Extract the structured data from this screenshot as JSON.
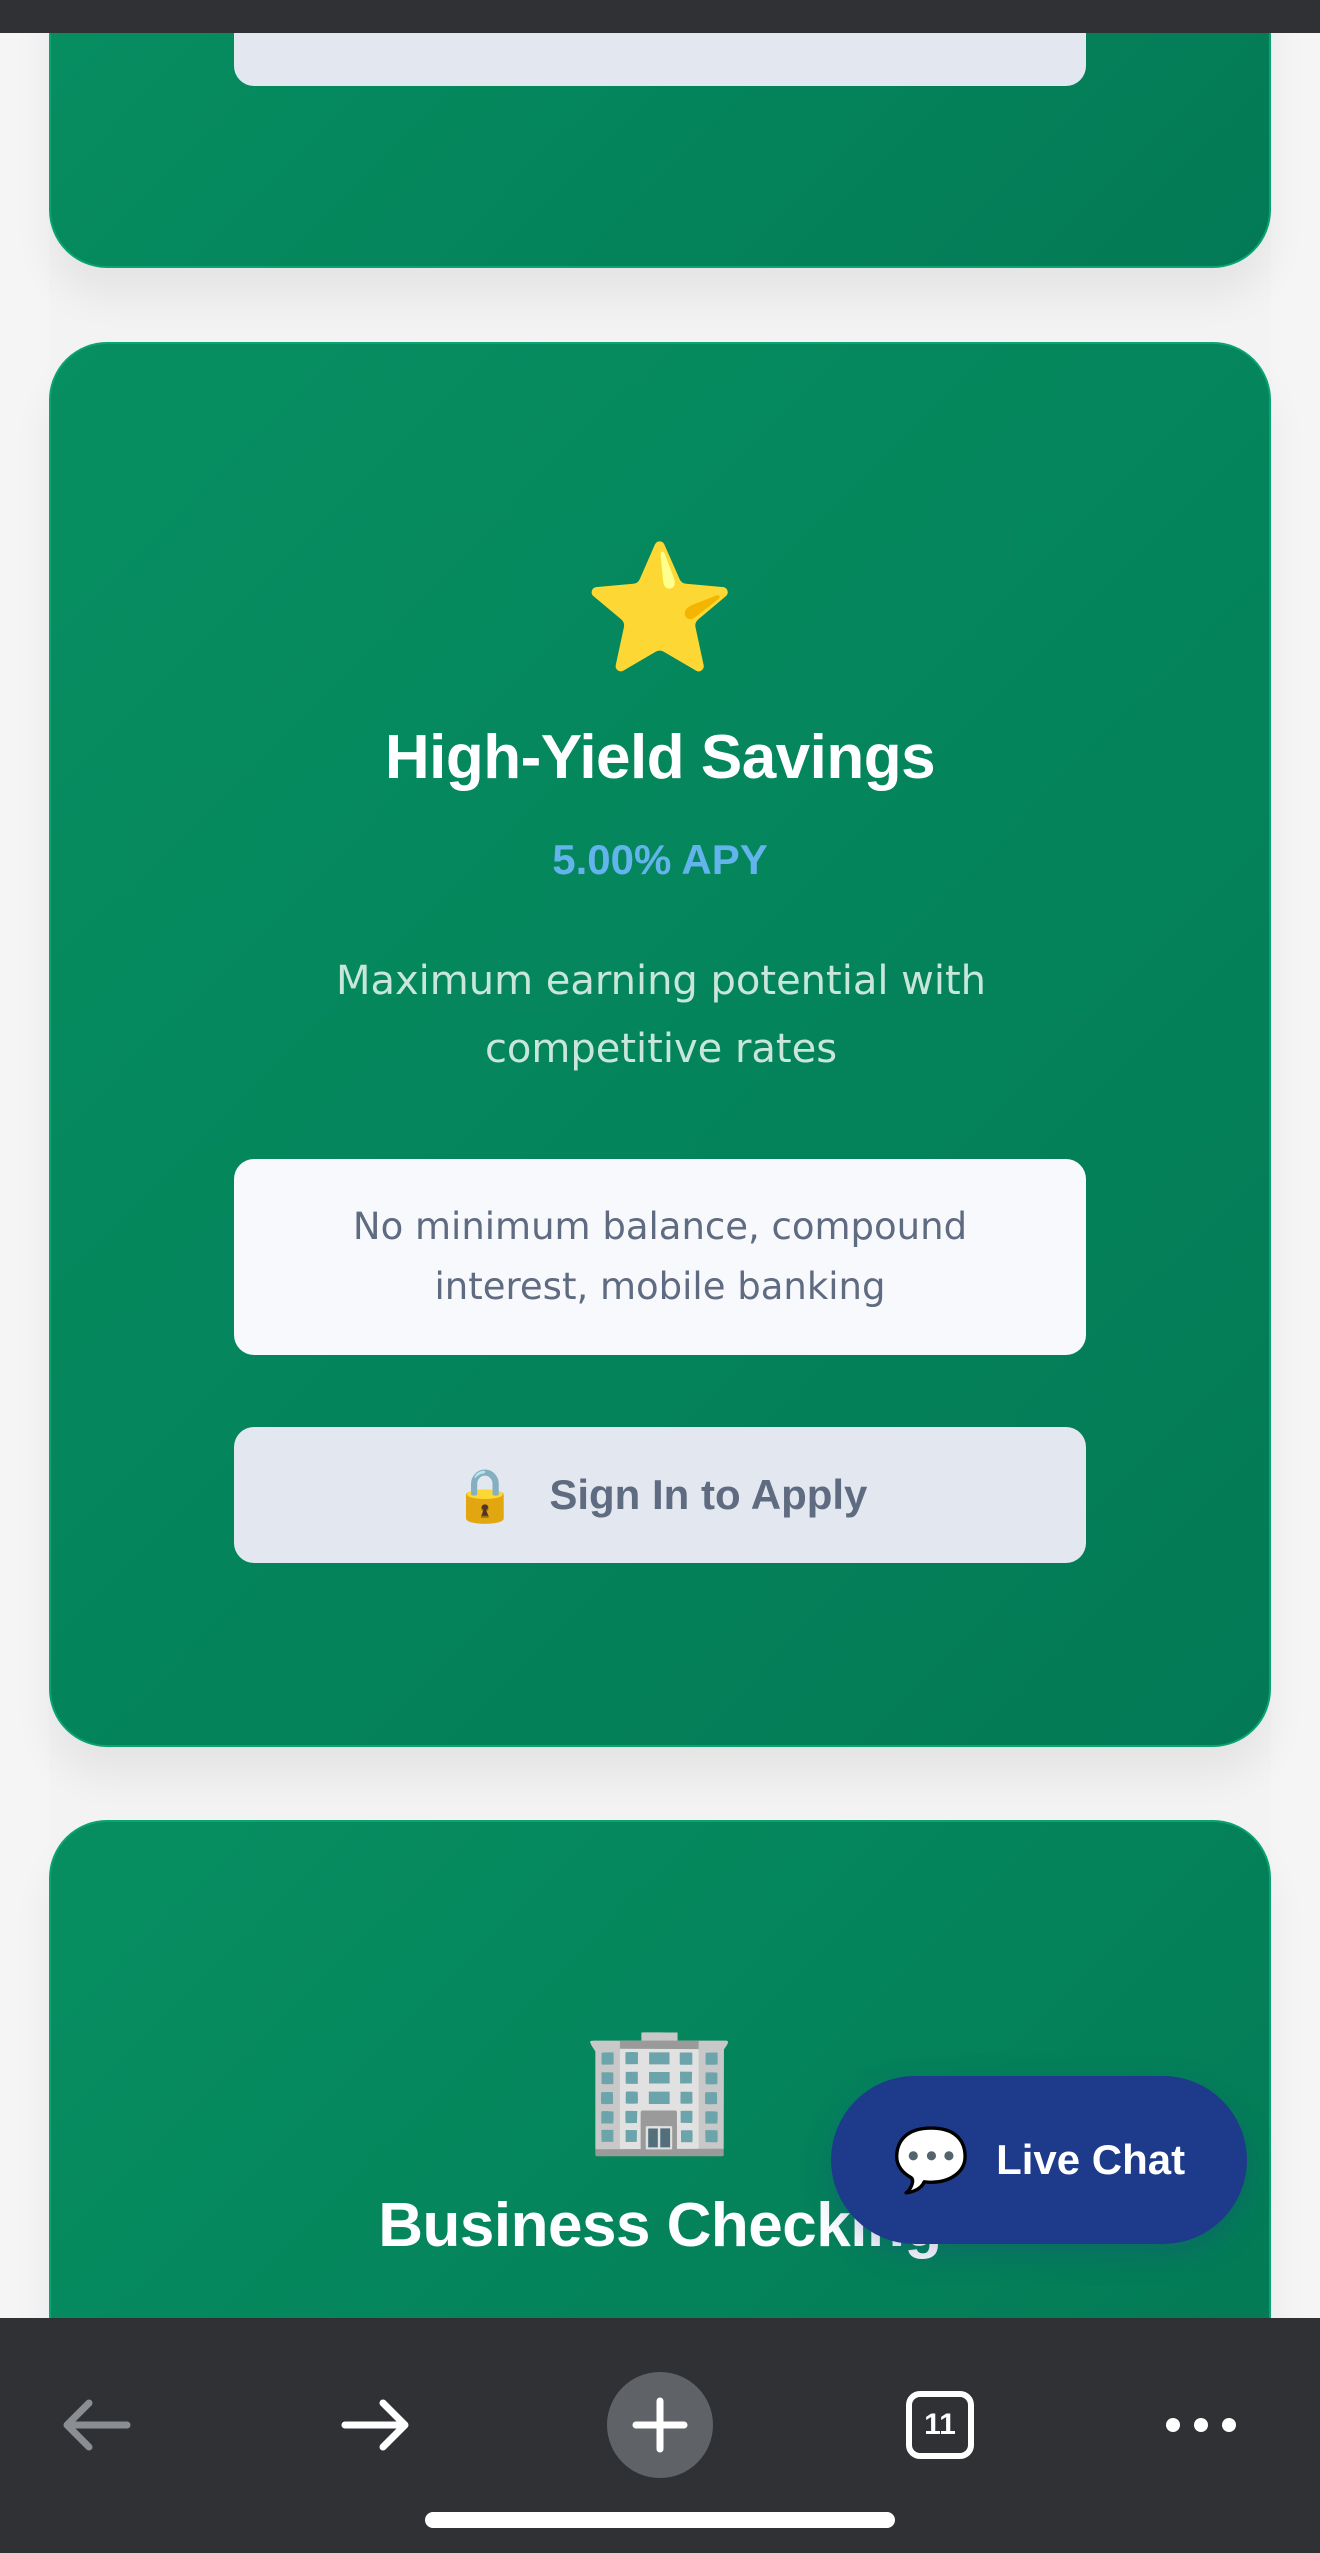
{
  "cards": [
    {
      "id": "partial-top",
      "apply_button_partial": true
    },
    {
      "id": "high-yield-savings",
      "icon": "⭐",
      "icon_name": "star-icon",
      "title": "High-Yield Savings",
      "rate": "5.00% APY",
      "description": "Maximum earning potential with competitive rates",
      "features": "No minimum balance, compound interest, mobile banking",
      "apply_label": "Sign In to Apply",
      "apply_icon": "🔒",
      "apply_icon_name": "lock-icon"
    },
    {
      "id": "business-checking",
      "icon": "🏢",
      "icon_name": "office-building-icon",
      "title": "Business Checking"
    }
  ],
  "live_chat": {
    "label": "Live Chat",
    "icon": "💬",
    "icon_name": "speech-bubble-icon"
  },
  "browser_toolbar": {
    "tab_count": "11"
  },
  "colors": {
    "card_green": "#068f61",
    "rate_blue": "#63b3ed",
    "chat_navy": "#1e3a8a",
    "button_gray": "#e3e8f0",
    "toolbar_dark": "#303134"
  }
}
